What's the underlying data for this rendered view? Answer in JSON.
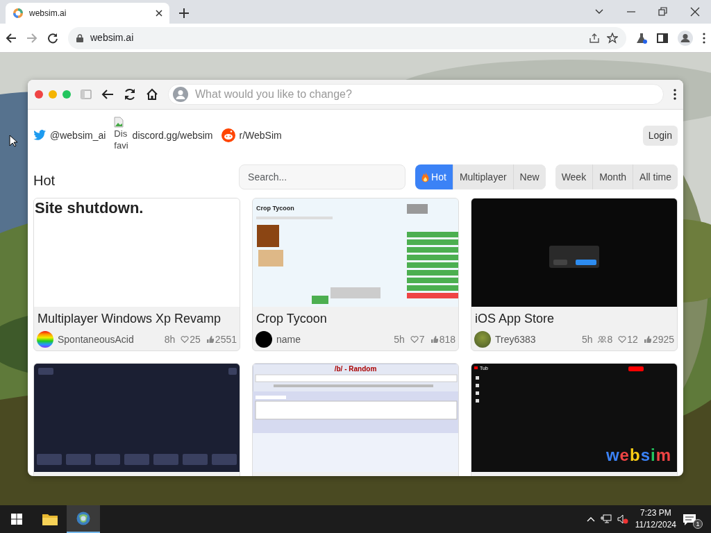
{
  "browser": {
    "tab_title": "websim.ai",
    "url": "websim.ai"
  },
  "app_window": {
    "prompt_placeholder": "What would you like to change?"
  },
  "social_links": [
    {
      "kind": "twitter",
      "label": "@websim_ai"
    },
    {
      "kind": "broken_image",
      "alt_lines": [
        "Dis",
        "favi"
      ],
      "label": "discord.gg/websim"
    },
    {
      "kind": "reddit",
      "label": "r/WebSim"
    }
  ],
  "login_button": "Login",
  "section_title": "Hot",
  "search": {
    "placeholder": "Search..."
  },
  "sort_tabs": [
    {
      "label": "Hot",
      "selected": true,
      "kind": "flame"
    },
    {
      "label": "Multiplayer",
      "selected": false,
      "kind": "plain"
    },
    {
      "label": "New",
      "selected": false,
      "kind": "plain"
    }
  ],
  "period_tabs": [
    {
      "label": "Week",
      "selected": false
    },
    {
      "label": "Month",
      "selected": false
    },
    {
      "label": "All time",
      "selected": false
    }
  ],
  "cards": [
    {
      "title": "Multiplayer Windows Xp Revamp",
      "author": "SpontaneousAcid",
      "avatar": {
        "kind": "rainbow"
      },
      "preview": {
        "kind": "text_page",
        "heading": "Site shutdown."
      },
      "stats": [
        {
          "kind": "time",
          "text": "8h"
        },
        {
          "kind": "likes",
          "text": "25"
        },
        {
          "kind": "views",
          "text": "2551"
        }
      ]
    },
    {
      "title": "Crop Tycoon",
      "author": "name",
      "avatar": {
        "kind": "black"
      },
      "preview": {
        "kind": "crop_game",
        "heading": "Crop Tycoon"
      },
      "stats": [
        {
          "kind": "time",
          "text": "5h"
        },
        {
          "kind": "likes",
          "text": "7"
        },
        {
          "kind": "views",
          "text": "818"
        }
      ]
    },
    {
      "title": "iOS App Store",
      "author": "Trey6383",
      "avatar": {
        "kind": "frog"
      },
      "preview": {
        "kind": "dark_dialog"
      },
      "stats": [
        {
          "kind": "time",
          "text": "5h"
        },
        {
          "kind": "remixes",
          "text": "8"
        },
        {
          "kind": "likes",
          "text": "12"
        },
        {
          "kind": "views",
          "text": "2925"
        }
      ]
    },
    {
      "preview": {
        "kind": "dark_buttons"
      }
    },
    {
      "preview": {
        "kind": "imageboard",
        "heading": "/b/ - Random"
      }
    },
    {
      "preview": {
        "kind": "video_site",
        "heading": "Tub",
        "logo": "websim"
      }
    }
  ],
  "taskbar": {
    "time": "7:23 PM",
    "date": "11/12/2024",
    "notifications": "1"
  }
}
